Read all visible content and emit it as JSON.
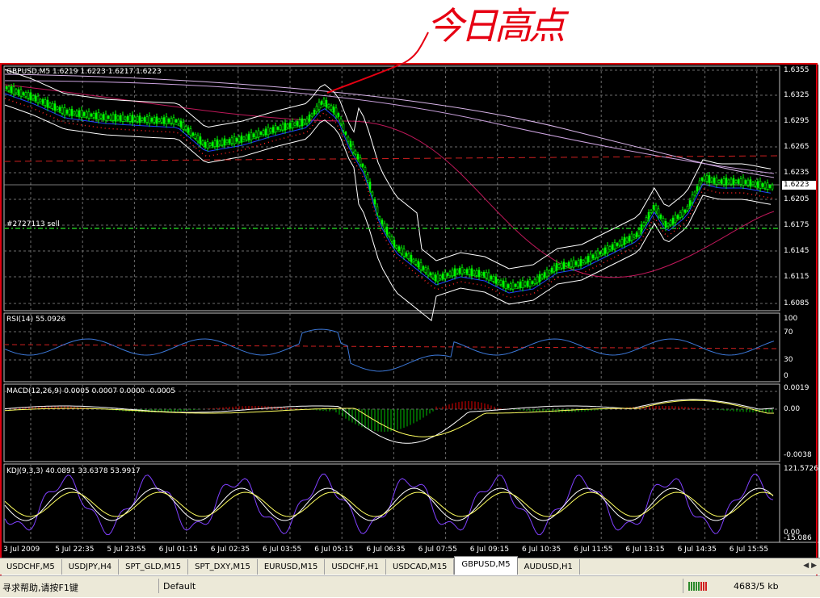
{
  "annotation": "今日高点",
  "main_pane": {
    "header": "GBPUSD,M5  1.6219 1.6223 1.6217 1.6223",
    "price_ticks": [
      "1.6355",
      "1.6325",
      "1.6295",
      "1.6265",
      "1.6235",
      "1.6205",
      "1.6175",
      "1.6145",
      "1.6115",
      "1.6085"
    ],
    "current_price": "1.6223",
    "order_label": "#2727113 sell"
  },
  "rsi_pane": {
    "header": "RSI(14) 55.0926",
    "ticks": [
      "100",
      "70",
      "30",
      "0"
    ]
  },
  "macd_pane": {
    "header": "MACD(12,26,9) 0.0005 0.0007 0.0000 -0.0005",
    "ticks": [
      "0.0019",
      "0.00",
      "-0.0038"
    ]
  },
  "kdj_pane": {
    "header": "KDJ(9,3,3) 40.0891 33.6378 53.9917",
    "ticks": [
      "121.5726",
      "0.00",
      "-15.086"
    ]
  },
  "time_axis": [
    "3 Jul 2009",
    "5 Jul 22:35",
    "5 Jul 23:55",
    "6 Jul 01:15",
    "6 Jul 02:35",
    "6 Jul 03:55",
    "6 Jul 05:15",
    "6 Jul 06:35",
    "6 Jul 07:55",
    "6 Jul 09:15",
    "6 Jul 10:35",
    "6 Jul 11:55",
    "6 Jul 13:15",
    "6 Jul 14:35",
    "6 Jul 15:55"
  ],
  "tabs": [
    {
      "label": "USDCHF,M5",
      "active": false
    },
    {
      "label": "USDJPY,H4",
      "active": false
    },
    {
      "label": "SPT_GLD,M15",
      "active": false
    },
    {
      "label": "SPT_DXY,M15",
      "active": false
    },
    {
      "label": "EURUSD,M15",
      "active": false
    },
    {
      "label": "USDCHF,H1",
      "active": false
    },
    {
      "label": "USDCAD,M15",
      "active": false
    },
    {
      "label": "GBPUSD,M5",
      "active": true
    },
    {
      "label": "AUDUSD,H1",
      "active": false
    }
  ],
  "tab_arrows": "◀ ▶",
  "status": {
    "help": "寻求帮助,请按F1键",
    "profile": "Default",
    "traffic": "4683/5 kb"
  },
  "colors": {
    "background": "#000000",
    "candle": "#00ff00",
    "grid": "#6b6b6b",
    "annotation": "#e60012",
    "rsi": "#3c78d8"
  }
}
